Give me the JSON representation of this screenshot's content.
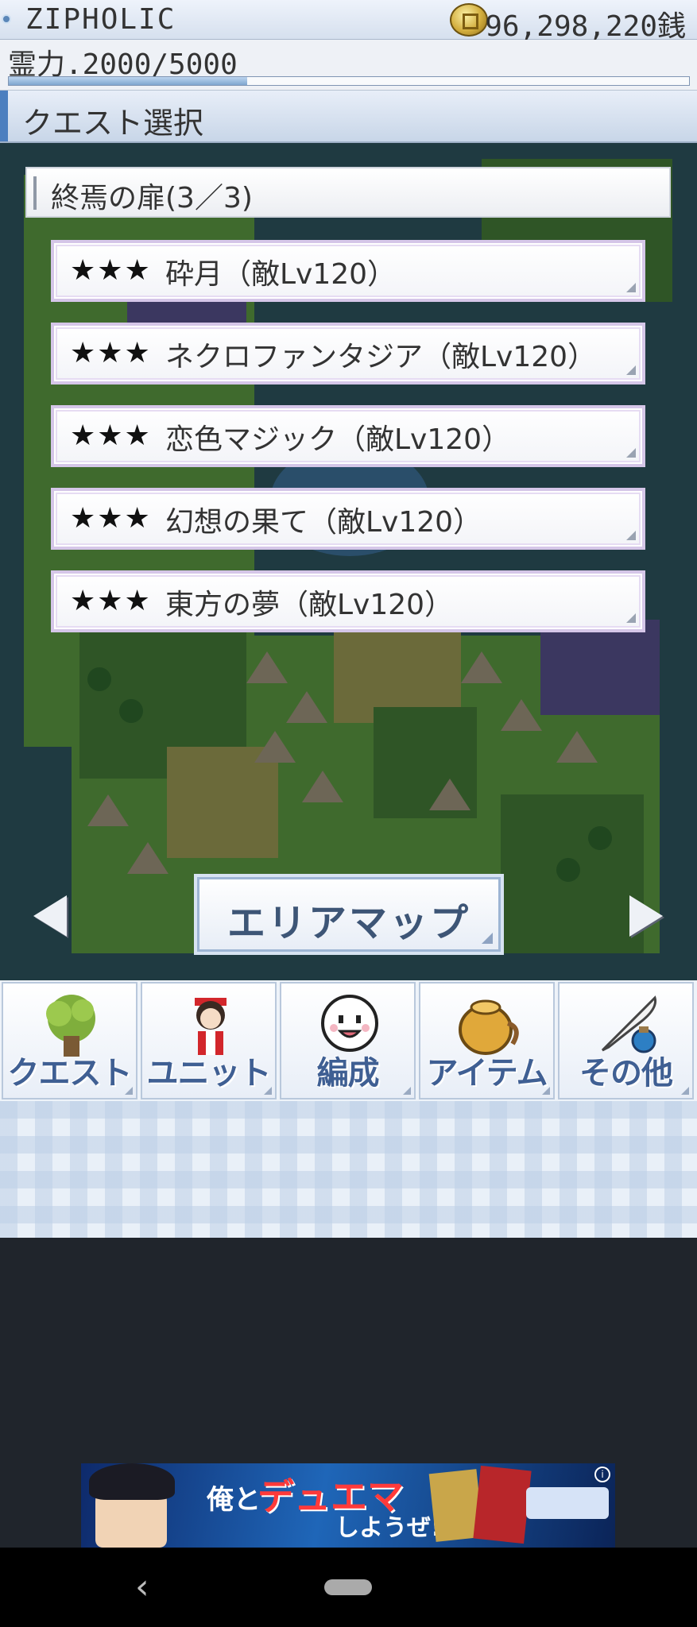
{
  "header": {
    "app_name": "ZIPHOLIC",
    "money": "96,298,220銭",
    "spirit": "霊力.2000/5000",
    "spirit_fraction": 0.35
  },
  "section": {
    "title": "クエスト選択"
  },
  "quest_list": {
    "header": "終焉の扉(3／3)",
    "items": [
      {
        "stars": "★★★",
        "name": "砕月（敵Lv120）"
      },
      {
        "stars": "★★★",
        "name": "ネクロファンタジア（敵Lv120）"
      },
      {
        "stars": "★★★",
        "name": "恋色マジック（敵Lv120）"
      },
      {
        "stars": "★★★",
        "name": "幻想の果て（敵Lv120）"
      },
      {
        "stars": "★★★",
        "name": "東方の夢（敵Lv120）"
      }
    ]
  },
  "map_nav": {
    "area_map_label": "エリアマップ"
  },
  "bottom_menu": [
    {
      "label": "クエスト",
      "icon": "tree-icon"
    },
    {
      "label": "ユニット",
      "icon": "shrine-maiden-icon"
    },
    {
      "label": "編成",
      "icon": "ghost-face-icon"
    },
    {
      "label": "アイテム",
      "icon": "bag-icon"
    },
    {
      "label": "その他",
      "icon": "quill-ink-icon"
    }
  ],
  "ad": {
    "text_1": "俺と",
    "text_2": "デュエマ",
    "text_3": "しようぜ!"
  },
  "colors": {
    "accent": "#4c7fbf",
    "menu_label": "#3f5f93",
    "area_map_label": "#3d5576"
  }
}
